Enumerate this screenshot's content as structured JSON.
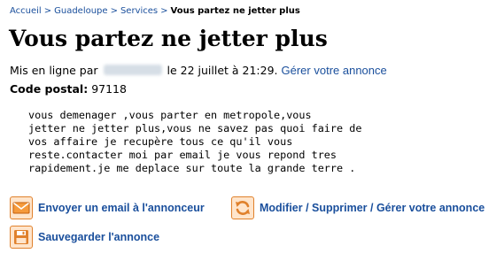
{
  "breadcrumb": {
    "items": [
      "Accueil",
      "Guadeloupe",
      "Services"
    ],
    "separator": ">",
    "current": "Vous partez ne jetter plus"
  },
  "listing": {
    "title": "Vous partez ne jetter plus",
    "posted_prefix": "Mis en ligne par",
    "posted_date": "le 22 juillet à 21:29.",
    "manage_link": "Gérer votre annonce",
    "postal_label": "Code postal:",
    "postal_value": "97118",
    "description": "vous demenager ,vous parter en metropole,vous\njetter ne jetter plus,vous ne savez pas quoi faire de\nvos affaire je recupère tous ce qu'il vous\nreste.contacter moi par email je vous repond tres\nrapidement.je me deplace sur toute la grande terre ."
  },
  "actions": {
    "email": {
      "label": "Envoyer un email à l'annonceur",
      "icon": "envelope-icon"
    },
    "edit": {
      "label": "Modifier / Supprimer / Gérer votre annonce",
      "icon": "refresh-icon"
    },
    "save": {
      "label": "Sauvegarder l'annonce",
      "icon": "floppy-disk-icon"
    }
  },
  "colors": {
    "link": "#1a4f9c",
    "icon_accent": "#e0812c",
    "icon_bg": "#ffe5cc"
  }
}
